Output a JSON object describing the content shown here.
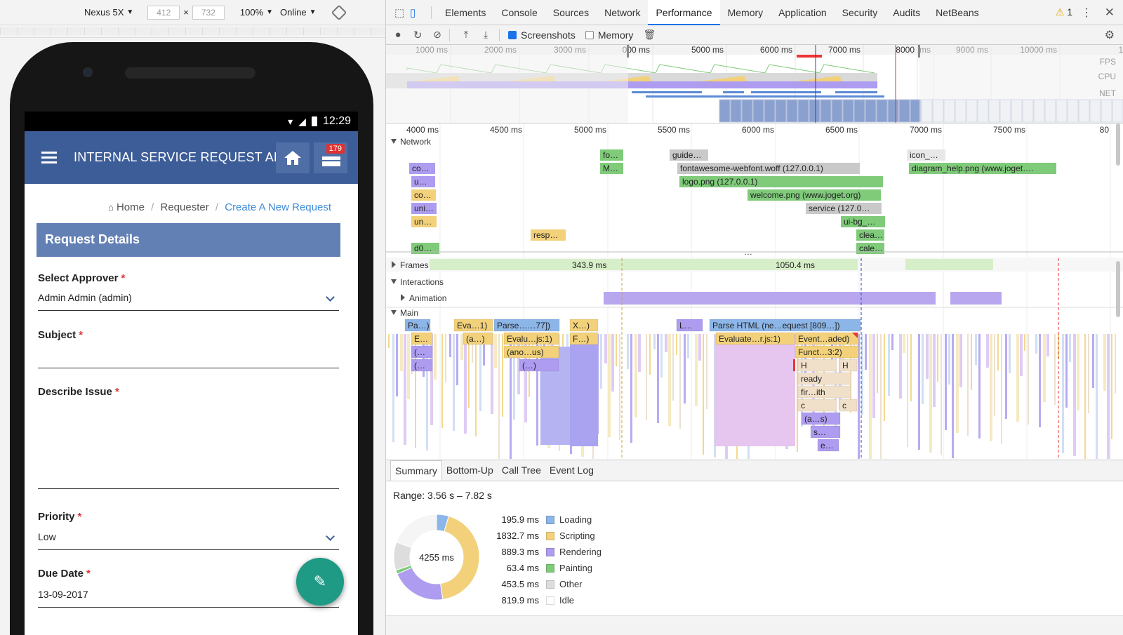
{
  "device_toolbar": {
    "device": "Nexus 5X",
    "width": "412",
    "times": "×",
    "height": "732",
    "zoom": "100%",
    "network": "Online"
  },
  "phone": {
    "time": "12:29",
    "app_title": "INTERNAL SERVICE REQUEST AP",
    "badge": "179",
    "breadcrumb": {
      "home": "Home",
      "requester": "Requester",
      "current": "Create A New Request",
      "sep": "/"
    },
    "panel_title": "Request Details",
    "fields": {
      "approver_label": "Select Approver",
      "approver_value": "Admin Admin (admin)",
      "subject_label": "Subject",
      "subject_value": "",
      "issue_label": "Describe Issue",
      "priority_label": "Priority",
      "priority_value": "Low",
      "due_label": "Due Date",
      "due_value": "13-09-2017",
      "required_mark": "*"
    }
  },
  "devtools": {
    "tabs": [
      "Elements",
      "Console",
      "Sources",
      "Network",
      "Performance",
      "Memory",
      "Application",
      "Security",
      "Audits",
      "NetBeans"
    ],
    "active_tab": "Performance",
    "warnings": "1",
    "toolbar": {
      "screenshots": "Screenshots",
      "memory": "Memory"
    },
    "overview": {
      "ticks": [
        "1000 ms",
        "2000 ms",
        "3000 ms",
        "000 ms",
        "5000 ms",
        "6000 ms",
        "7000 ms",
        "8000",
        "ms",
        "9000 ms",
        "10000 ms",
        "11"
      ],
      "lanes": [
        "FPS",
        "CPU",
        "NET"
      ]
    },
    "timeline": {
      "ticks": [
        "4000 ms",
        "4500 ms",
        "5000 ms",
        "5500 ms",
        "6000 ms",
        "6500 ms",
        "7000 ms",
        "7500 ms",
        "80"
      ],
      "network_label": "Network",
      "network_requests": [
        "fo…",
        "guide…",
        "M…",
        "fontawesome-webfont.woff (127.0.0.1)",
        "logo.png (127.0.0.1)",
        "welcome.png (www.joget.org)",
        "service (127.0…",
        "ui-bg_…",
        "clea…",
        "cale…",
        "icon_…",
        "diagram_help.png (www.joget….",
        "co…",
        "u…",
        "co…",
        "uni…",
        "un…",
        "resp…",
        "d0…"
      ],
      "frames_label": "Frames",
      "frame_times": [
        "343.9 ms",
        "1050.4 ms"
      ],
      "interactions_label": "Interactions",
      "animation_label": "Animation",
      "main_label": "Main",
      "main_tasks": [
        "Pa…)",
        "Eva…1)",
        "Parse……77])",
        "X…)",
        "L…",
        "Parse HTML (ne…equest [809…])",
        "E…",
        "(a…)",
        "Evalu…js:1)",
        "F…)",
        "Evaluate…r.js:1)",
        "Event…aded)",
        "(…",
        "(ano…us)",
        "Funct…3:2)",
        "(…",
        "(…)",
        "H",
        "H",
        "ready",
        "fir…ith",
        "c",
        "c",
        "(a…s)",
        "s…",
        "e…"
      ]
    },
    "sub_tabs": [
      "Summary",
      "Bottom-Up",
      "Call Tree",
      "Event Log"
    ],
    "active_sub_tab": "Summary",
    "summary": {
      "range": "Range: 3.56 s – 7.82 s",
      "total": "4255 ms",
      "items": [
        {
          "value": "195.9 ms",
          "label": "Loading",
          "color": "#8cb5e8"
        },
        {
          "value": "1832.7 ms",
          "label": "Scripting",
          "color": "#f2d17a"
        },
        {
          "value": "889.3 ms",
          "label": "Rendering",
          "color": "#ad9cf0"
        },
        {
          "value": "63.4 ms",
          "label": "Painting",
          "color": "#7fcb7a"
        },
        {
          "value": "453.5 ms",
          "label": "Other",
          "color": "#dddddd"
        },
        {
          "value": "819.9 ms",
          "label": "Idle",
          "color": "#ffffff"
        }
      ]
    }
  },
  "colors": {
    "app_bar": "#3d5d98",
    "panel_head": "#6380b5",
    "fab": "#1f9a84",
    "link": "#3d8ad8",
    "devtools_accent": "#1a73e8"
  }
}
